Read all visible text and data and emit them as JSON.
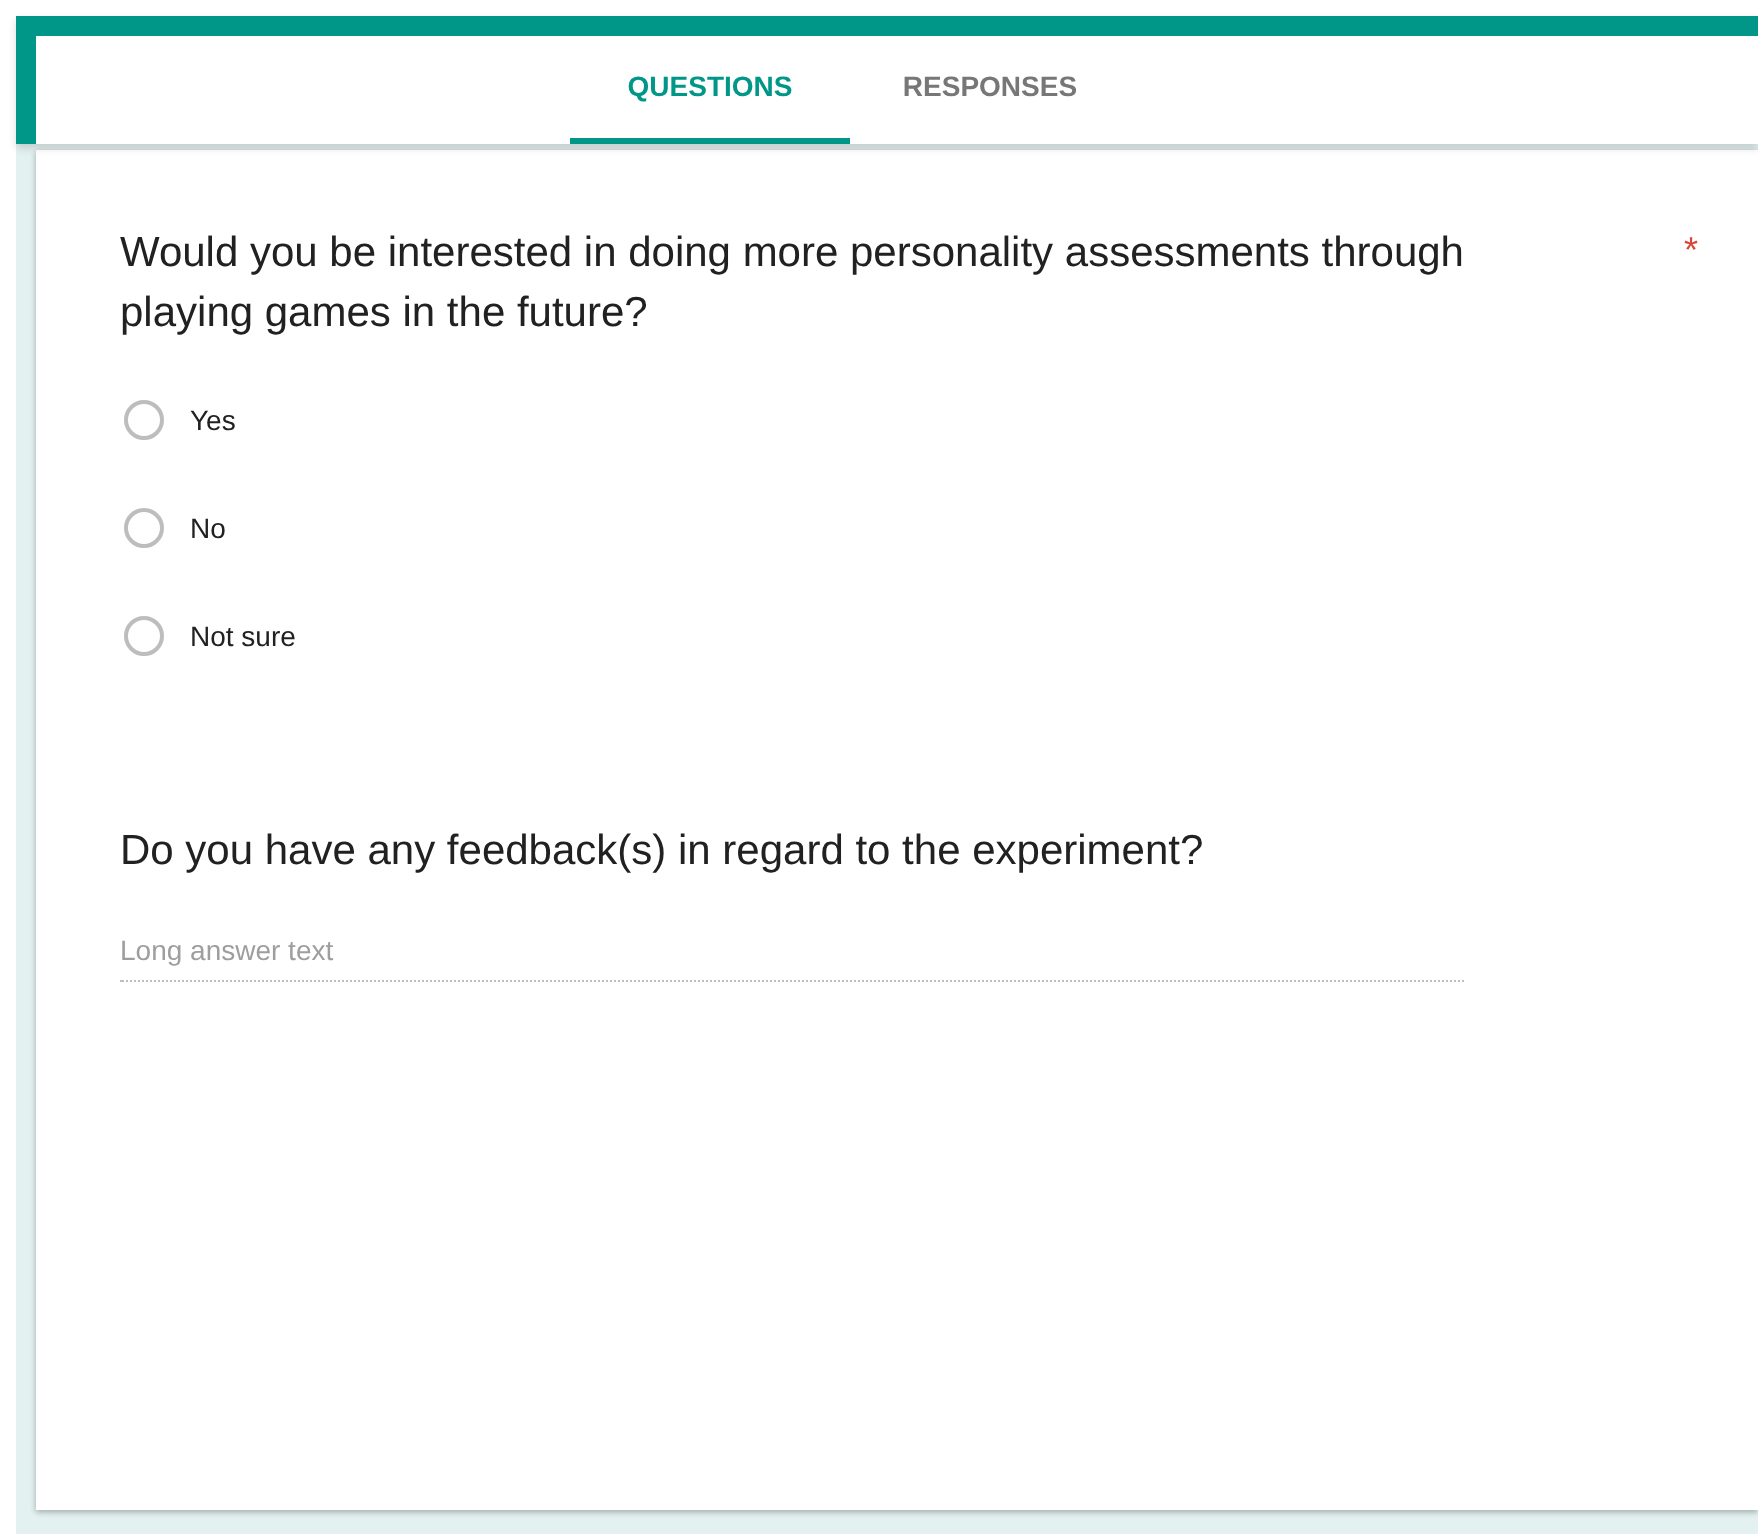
{
  "tabs": [
    {
      "label": "QUESTIONS",
      "selected": true
    },
    {
      "label": "RESPONSES",
      "selected": false
    }
  ],
  "questions": [
    {
      "kind": "choice",
      "title": "Would you be interested in doing more personality assessments through playing games in the future?",
      "required_mark": "*",
      "options": [
        {
          "label": "Yes",
          "selected": false
        },
        {
          "label": "No",
          "selected": false
        },
        {
          "label": "Not sure",
          "selected": false
        }
      ]
    },
    {
      "kind": "paragraph",
      "title": "Do you have any feedback(s) in regard to the experiment?",
      "placeholder": "Long answer text"
    }
  ]
}
